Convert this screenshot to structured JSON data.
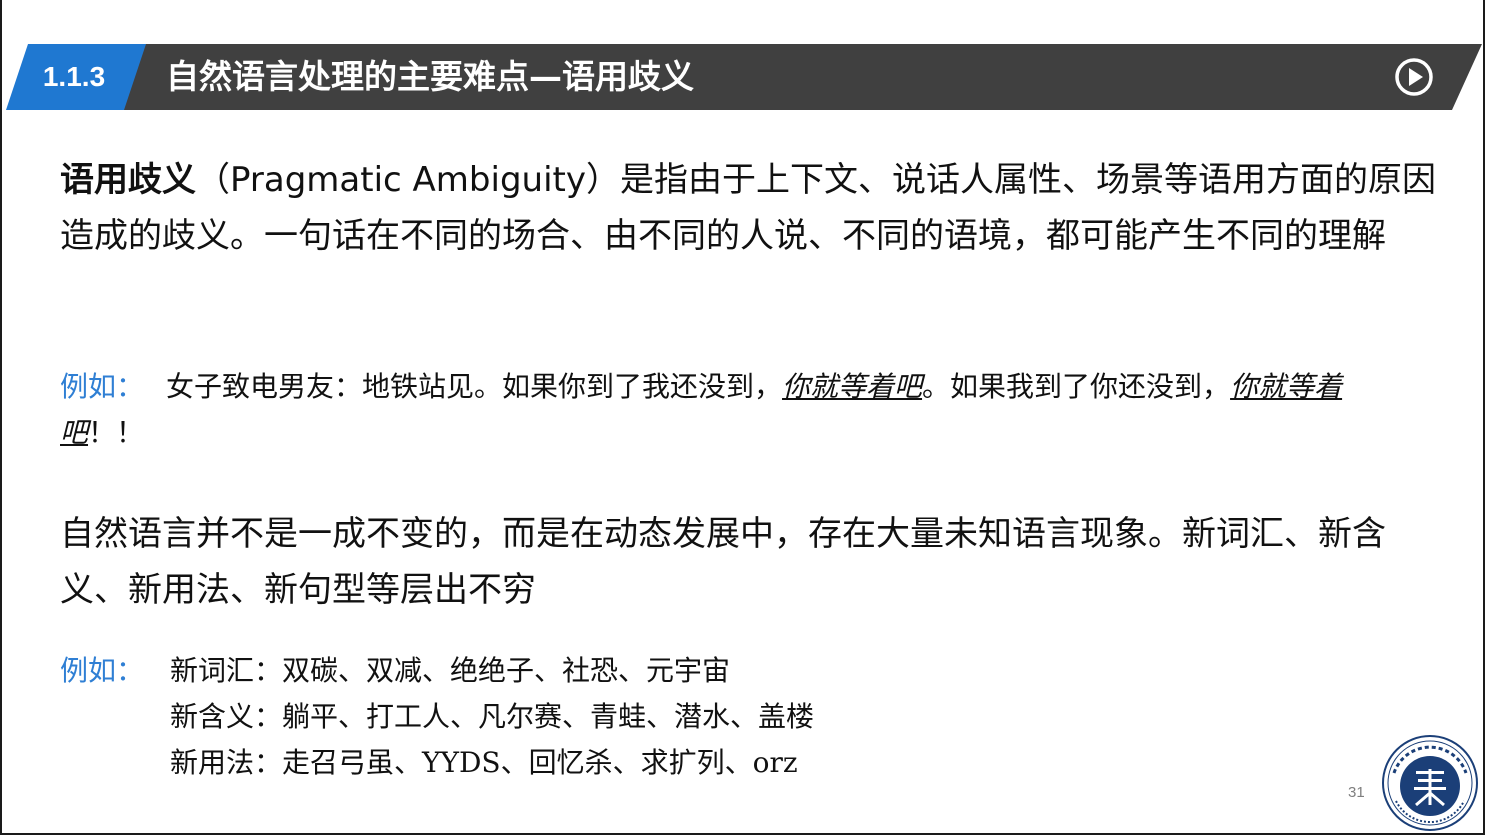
{
  "header": {
    "section_number": "1.1.3",
    "title": "自然语言处理的主要难点—语用歧义",
    "play_icon": "play-circle-icon"
  },
  "paragraph1": {
    "term": "语用歧义",
    "text": "（Pragmatic  Ambiguity）是指由于上下文、说话人属性、场景等语用方面的原因造成的歧义。一句话在不同的场合、由不同的人说、不同的语境，都可能产生不同的理解"
  },
  "example1": {
    "label": "例如：",
    "part1": "女子致电男友：地铁站见。如果你到了我还没到，",
    "em1": "你就等着吧",
    "part2": "。如果我到了你还没到，",
    "em2": "你就等着吧",
    "part3": "！！"
  },
  "paragraph2": {
    "text": "自然语言并不是一成不变的，而是在动态发展中，存在大量未知语言现象。新词汇、新含义、新用法、新句型等层出不穷"
  },
  "example2": {
    "label": "例如：",
    "lines": [
      "新词汇：双碳、双减、绝绝子、社恐、元宇宙",
      "新含义：躺平、打工人、凡尔赛、青蛙、潜水、盖楼",
      "新用法：走召弓虽、YYDS、回忆杀、求扩列、orz"
    ]
  },
  "footer": {
    "page_number": "31",
    "logo": "university-seal-logo"
  },
  "colors": {
    "header_bg": "#404040",
    "accent_blue": "#1f78d1",
    "label_blue": "#2f7fd4",
    "seal_navy": "#1b3f78"
  }
}
